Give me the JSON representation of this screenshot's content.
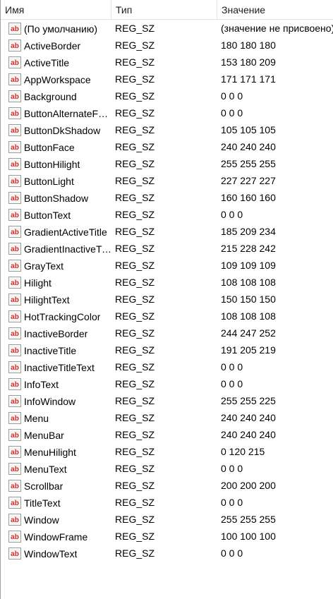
{
  "header": {
    "name": "Имя",
    "type": "Тип",
    "value": "Значение"
  },
  "icon": "string-value-icon",
  "icon_text": "ab",
  "rows": [
    {
      "name": "(По умолчанию)",
      "type": "REG_SZ",
      "value": "(значение не присвоено)"
    },
    {
      "name": "ActiveBorder",
      "type": "REG_SZ",
      "value": "180 180 180"
    },
    {
      "name": "ActiveTitle",
      "type": "REG_SZ",
      "value": "153 180 209"
    },
    {
      "name": "AppWorkspace",
      "type": "REG_SZ",
      "value": "171 171 171"
    },
    {
      "name": "Background",
      "type": "REG_SZ",
      "value": "0 0 0"
    },
    {
      "name": "ButtonAlternateFace",
      "type": "REG_SZ",
      "value": "0 0 0"
    },
    {
      "name": "ButtonDkShadow",
      "type": "REG_SZ",
      "value": "105 105 105"
    },
    {
      "name": "ButtonFace",
      "type": "REG_SZ",
      "value": "240 240 240"
    },
    {
      "name": "ButtonHilight",
      "type": "REG_SZ",
      "value": "255 255 255"
    },
    {
      "name": "ButtonLight",
      "type": "REG_SZ",
      "value": "227 227 227"
    },
    {
      "name": "ButtonShadow",
      "type": "REG_SZ",
      "value": "160 160 160"
    },
    {
      "name": "ButtonText",
      "type": "REG_SZ",
      "value": "0 0 0"
    },
    {
      "name": "GradientActiveTitle",
      "type": "REG_SZ",
      "value": "185 209 234"
    },
    {
      "name": "GradientInactiveTitle",
      "type": "REG_SZ",
      "value": "215 228 242"
    },
    {
      "name": "GrayText",
      "type": "REG_SZ",
      "value": "109 109 109"
    },
    {
      "name": "Hilight",
      "type": "REG_SZ",
      "value": "108 108 108"
    },
    {
      "name": "HilightText",
      "type": "REG_SZ",
      "value": "150 150 150"
    },
    {
      "name": "HotTrackingColor",
      "type": "REG_SZ",
      "value": "108 108 108"
    },
    {
      "name": "InactiveBorder",
      "type": "REG_SZ",
      "value": "244 247 252"
    },
    {
      "name": "InactiveTitle",
      "type": "REG_SZ",
      "value": "191 205 219"
    },
    {
      "name": "InactiveTitleText",
      "type": "REG_SZ",
      "value": "0 0 0"
    },
    {
      "name": "InfoText",
      "type": "REG_SZ",
      "value": "0 0 0"
    },
    {
      "name": "InfoWindow",
      "type": "REG_SZ",
      "value": "255 255 225"
    },
    {
      "name": "Menu",
      "type": "REG_SZ",
      "value": "240 240 240"
    },
    {
      "name": "MenuBar",
      "type": "REG_SZ",
      "value": "240 240 240"
    },
    {
      "name": "MenuHilight",
      "type": "REG_SZ",
      "value": "0 120 215"
    },
    {
      "name": "MenuText",
      "type": "REG_SZ",
      "value": "0 0 0"
    },
    {
      "name": "Scrollbar",
      "type": "REG_SZ",
      "value": "200 200 200"
    },
    {
      "name": "TitleText",
      "type": "REG_SZ",
      "value": "0 0 0"
    },
    {
      "name": "Window",
      "type": "REG_SZ",
      "value": "255 255 255"
    },
    {
      "name": "WindowFrame",
      "type": "REG_SZ",
      "value": "100 100 100"
    },
    {
      "name": "WindowText",
      "type": "REG_SZ",
      "value": "0 0 0"
    }
  ]
}
